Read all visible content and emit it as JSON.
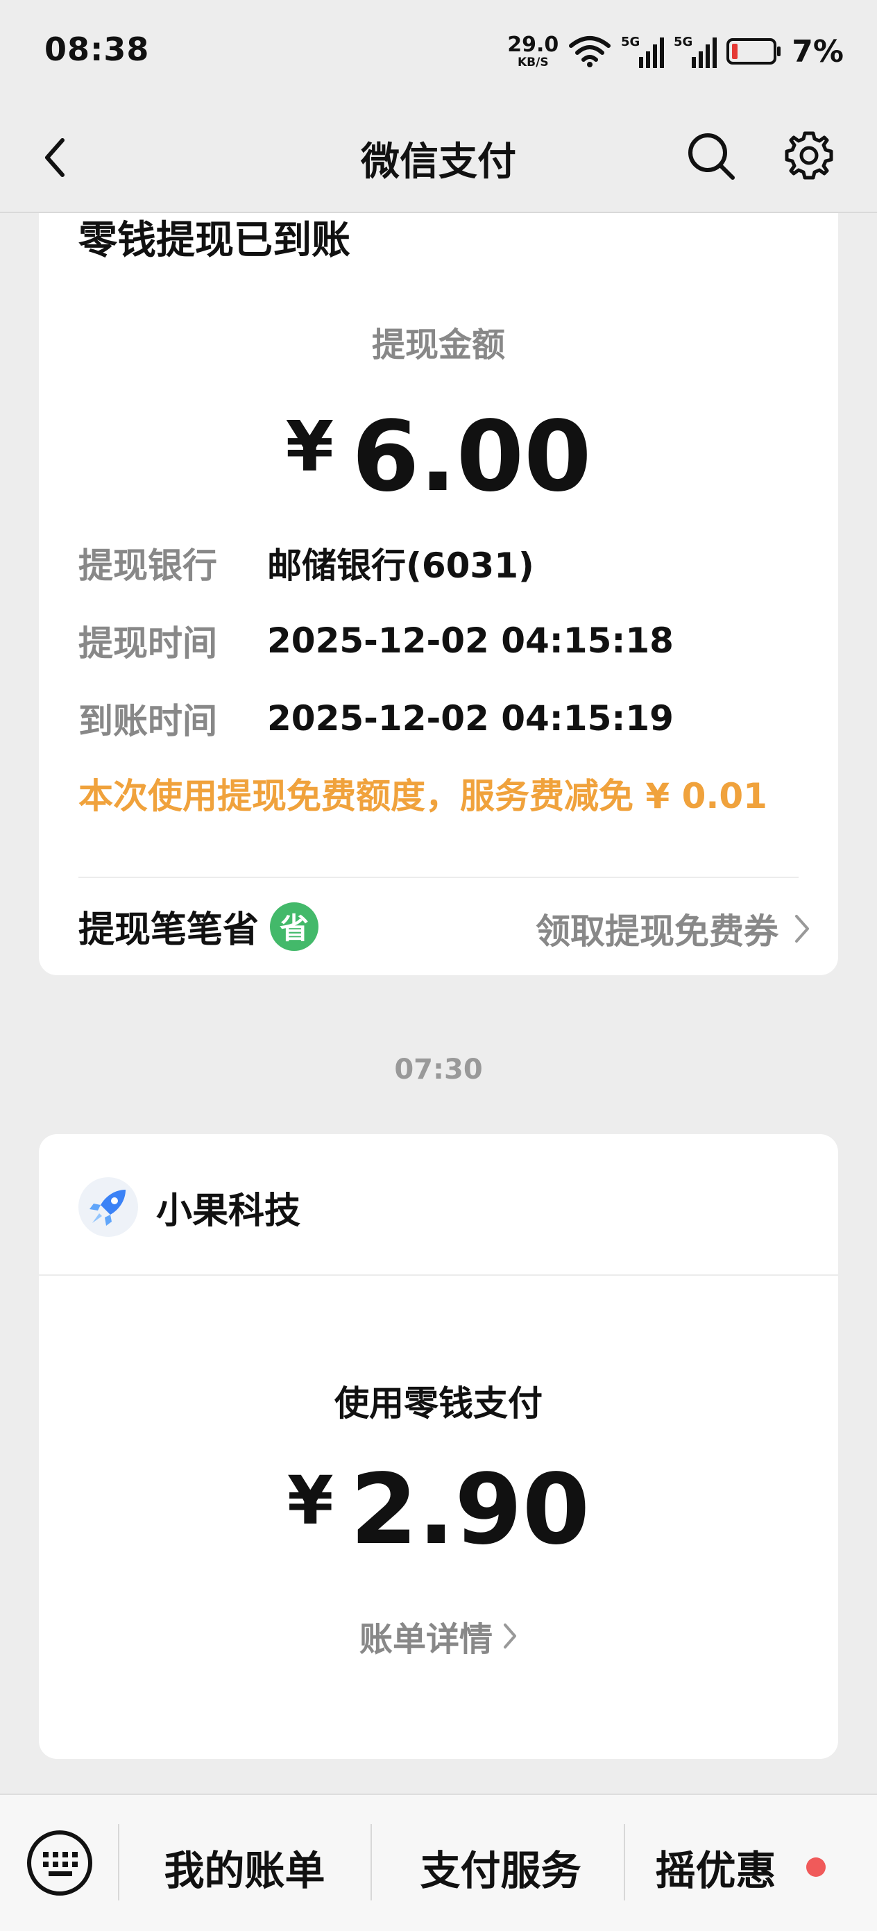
{
  "status_bar": {
    "time": "08:38",
    "net_speed_value": "29.0",
    "net_speed_unit": "KB/S",
    "signal_label": "5G",
    "battery_percent": "7%"
  },
  "nav": {
    "title": "微信支付"
  },
  "withdrawal_card": {
    "title": "零钱提现已到账",
    "amount_label": "提现金额",
    "currency": "¥",
    "amount": "6.00",
    "rows": [
      {
        "key": "提现银行",
        "value": "邮储银行(6031)"
      },
      {
        "key": "提现时间",
        "value": "2025-12-02 04:15:18"
      },
      {
        "key": "到账时间",
        "value": "2025-12-02 04:15:19"
      }
    ],
    "fee_note": "本次使用提现免费额度，服务费减免 ¥ 0.01",
    "promo_left": "提现笔笔省",
    "promo_badge": "省",
    "promo_right": "领取提现免费券"
  },
  "timestamp": "07:30",
  "payment_card": {
    "merchant_name": "小果科技",
    "pay_label": "使用零钱支付",
    "currency": "¥",
    "amount": "2.90",
    "detail_link": "账单详情"
  },
  "bottom_menu": {
    "items": [
      "我的账单",
      "支付服务",
      "摇优惠"
    ]
  },
  "colors": {
    "accent_orange": "#f0a23c",
    "badge_green": "#43b96a",
    "red_dot": "#f05a5a"
  }
}
